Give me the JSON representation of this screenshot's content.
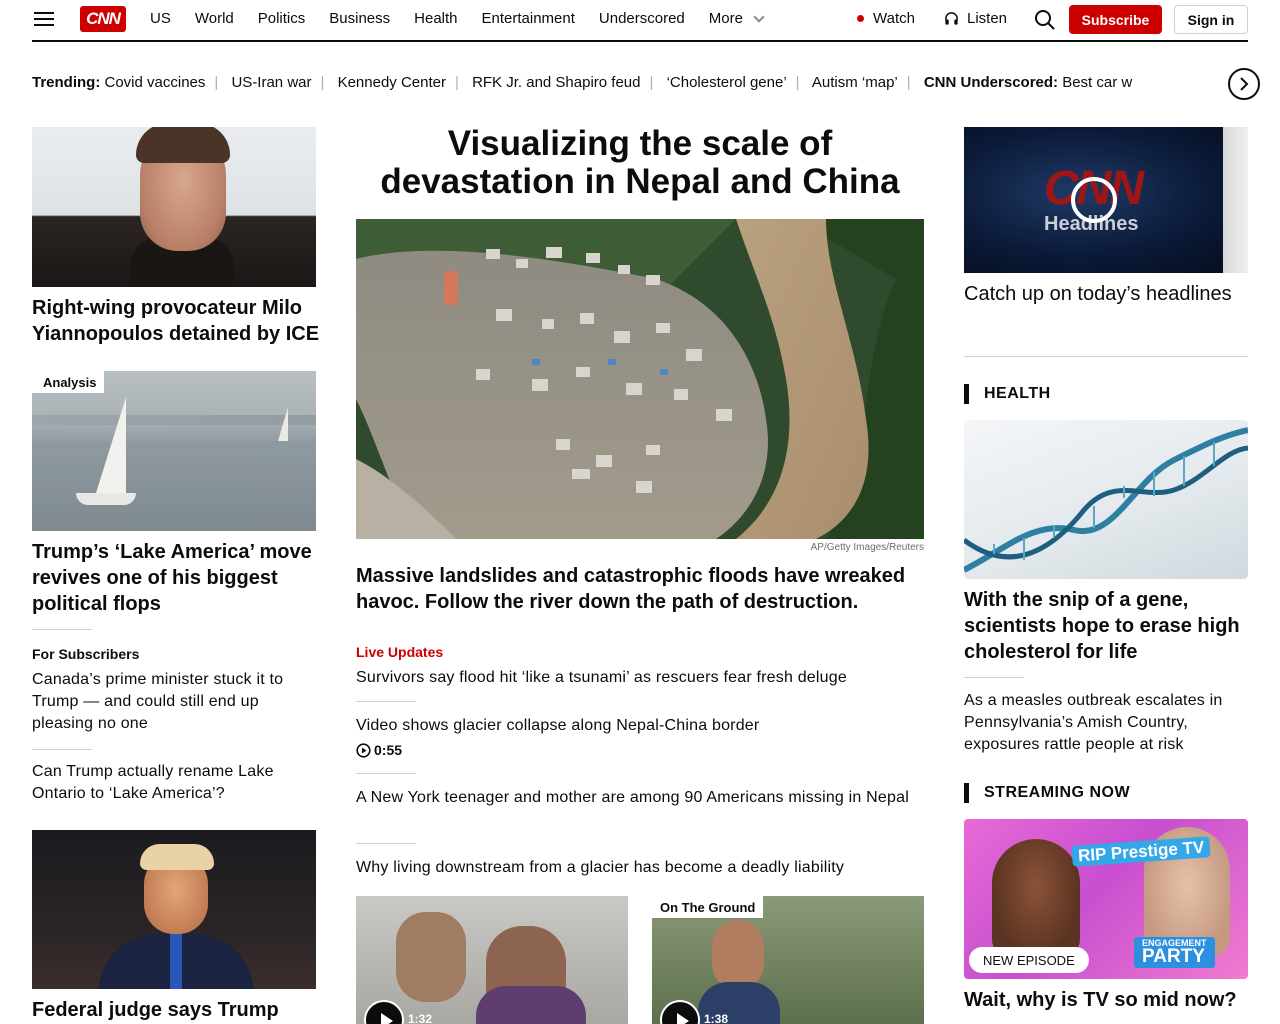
{
  "header": {
    "logo": "CNN",
    "nav": [
      "US",
      "World",
      "Politics",
      "Business",
      "Health",
      "Entertainment",
      "Underscored",
      "More"
    ],
    "watch": "Watch",
    "listen": "Listen",
    "subscribe": "Subscribe",
    "sign_in": "Sign in"
  },
  "trending": {
    "label": "Trending:",
    "items": [
      "Covid vaccines",
      "US-Iran war",
      "Kennedy Center",
      "RFK Jr. and Shapiro feud",
      "‘Cholesterol gene’",
      "Autism ‘map’"
    ],
    "underscored_label": "CNN Underscored:",
    "underscored_text": "Best car w"
  },
  "left": {
    "milo_headline": "Right-wing provocateur Milo Yiannopoulos detained by ICE",
    "analysis_badge": "Analysis",
    "lake_headline": "Trump’s ‘Lake America’ move revives one of his biggest political flops",
    "for_subscribers": "For Subscribers",
    "canada_headline": "Canada’s prime minister stuck it to Trump — and could still end up pleasing no one",
    "rename_headline": "Can Trump actually rename Lake Ontario to ‘Lake America’?",
    "judge_headline": "Federal judge says Trump"
  },
  "center": {
    "title": "Visualizing the scale of devastation in Nepal and China",
    "caption": "AP/Getty Images/Reuters",
    "lead_deck": "Massive landslides and catastrophic floods have wreaked havoc. Follow the river down the path of destruction.",
    "live_label": "Live Updates",
    "items": [
      "Survivors say flood hit ‘like a tsunami’ as rescuers fear fresh deluge",
      "Video shows glacier collapse along Nepal-China border",
      "A New York teenager and mother are among 90 Americans missing in Nepal",
      "Why living downstream from a glacier has become a deadly liability"
    ],
    "video_duration": "0:55",
    "video1_duration": "1:32",
    "video2_duration": "1:38",
    "on_the_ground": "On The Ground"
  },
  "right": {
    "headlines_video_text": "Headlines",
    "headlines_cnn": "CNN",
    "catch_up": "Catch up on today’s headlines",
    "health_label": "HEALTH",
    "gene_headline": "With the snip of a gene, scientists hope to erase high cholesterol for life",
    "measles_headline": "As a measles outbreak escalates in Pennsylvania’s Amish Country, exposures rattle people at risk",
    "streaming_label": "STREAMING NOW",
    "rip_text": "RIP Prestige TV",
    "party_text_top": "ENGAGEMENT",
    "party_text": "PARTY",
    "new_episode": "NEW EPISODE",
    "tv_headline": "Wait, why is TV so mid now?"
  }
}
